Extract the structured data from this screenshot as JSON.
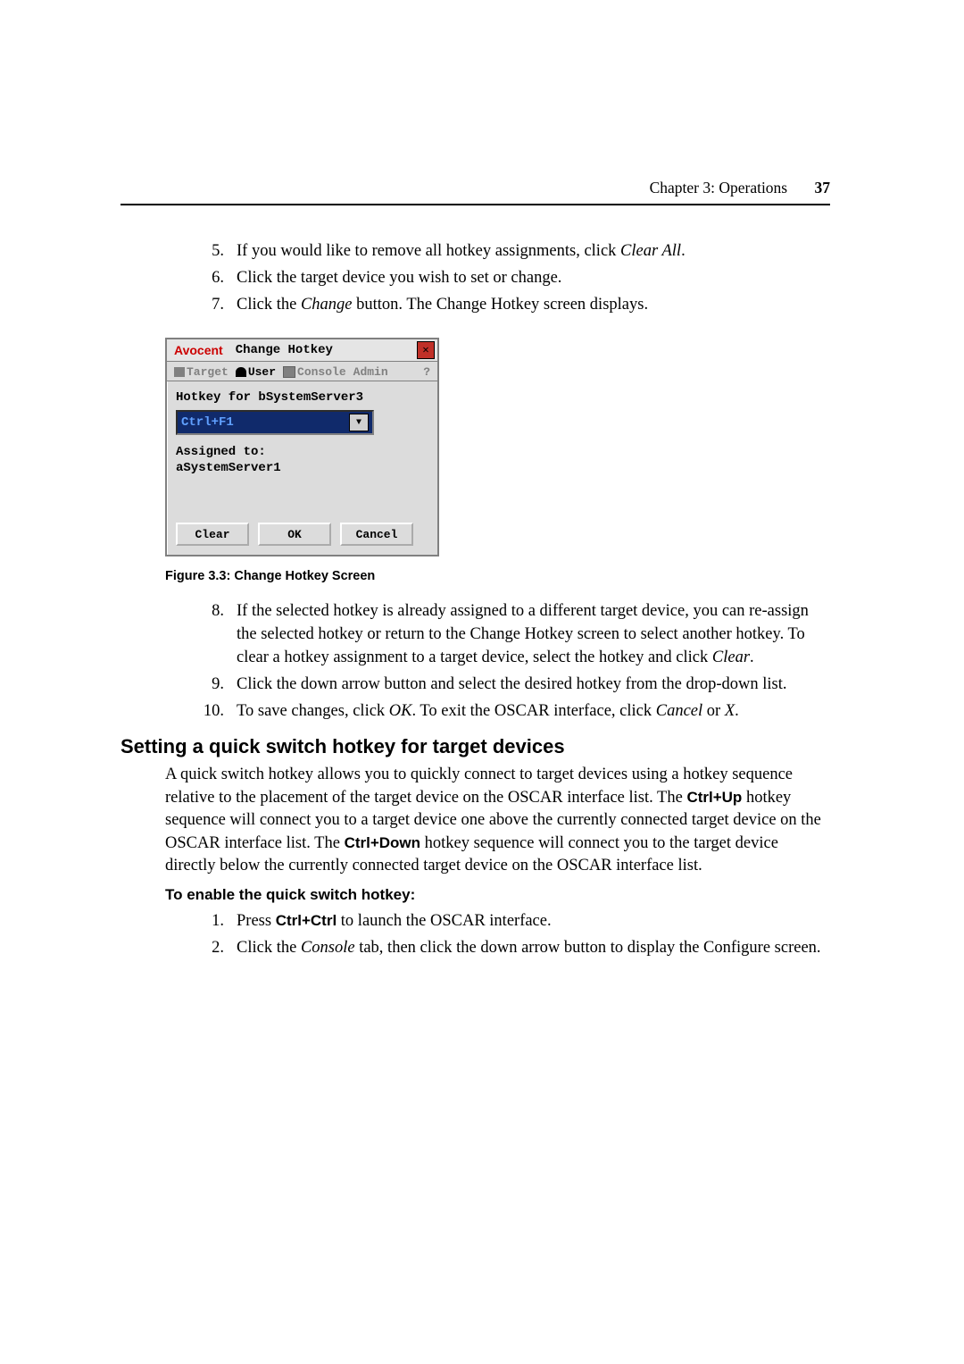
{
  "header": {
    "chapter": "Chapter 3: Operations",
    "page_number": "37"
  },
  "list_a": {
    "i5": {
      "num": "5.",
      "pre": "If you would like to remove all hotkey assignments, click ",
      "em": "Clear All",
      "post": "."
    },
    "i6": {
      "num": "6.",
      "txt": "Click the target device you wish to set or change."
    },
    "i7": {
      "num": "7.",
      "pre": "Click the ",
      "em": "Change",
      "post": " button. The Change Hotkey screen displays."
    }
  },
  "oscar": {
    "brand": "Avocent",
    "title": "Change Hotkey",
    "close": "✕",
    "tabs": {
      "target": "Target",
      "user": "User",
      "console": "Console",
      "admin": "Admin",
      "help": "?"
    },
    "hotkey_label": "Hotkey for bSystemServer3",
    "hotkey_value": "Ctrl+F1",
    "dropdown_glyph": "▼",
    "assigned_label": "Assigned to:",
    "assigned_value": "aSystemServer1",
    "btn_clear": "Clear",
    "btn_ok": "OK",
    "btn_cancel": "Cancel"
  },
  "caption": "Figure 3.3: Change Hotkey Screen",
  "list_b": {
    "i8": {
      "num": "8.",
      "pre": "If the selected hotkey is already assigned to a different target device, you can re-assign the selected hotkey or return to the Change Hotkey screen to select another hotkey. To clear a hotkey assignment to a target device, select the hotkey and click ",
      "em": "Clear",
      "post": "."
    },
    "i9": {
      "num": "9.",
      "txt": "Click the down arrow button and select the desired hotkey from the drop-down list."
    },
    "i10": {
      "num": "10.",
      "pre": "To save changes, click ",
      "em1": "OK",
      "mid": ". To exit the OSCAR interface, click ",
      "em2": "Cancel",
      "mid2": " or ",
      "em3": "X",
      "post": "."
    }
  },
  "h2": "Setting a quick switch hotkey for target devices",
  "para": {
    "p1a": "A quick switch hotkey allows you to quickly connect to target devices using a hotkey sequence relative to the placement of the target device on the OSCAR interface list. The ",
    "b1": "Ctrl+Up",
    "p1b": " hotkey sequence will connect you to a target device one above the currently connected target device on the OSCAR interface list. The ",
    "b2": "Ctrl+Down",
    "p1c": " hotkey sequence will connect you to the target device directly below the currently connected target device on the OSCAR interface list."
  },
  "h3": "To enable the quick switch hotkey:",
  "list_c": {
    "i1": {
      "num": "1.",
      "pre": "Press ",
      "b": "Ctrl+Ctrl",
      "post": " to launch the OSCAR interface."
    },
    "i2": {
      "num": "2.",
      "pre": "Click the ",
      "em": "Console",
      "post": " tab, then click the down arrow button to display the Configure screen."
    }
  }
}
